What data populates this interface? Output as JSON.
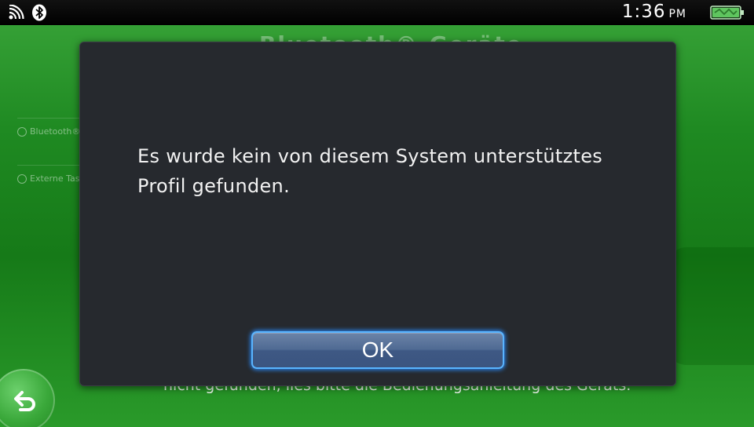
{
  "status_bar": {
    "time": "1:36",
    "ampm": "PM",
    "icons": [
      "wifi-icon",
      "bluetooth-icon",
      "battery-icon"
    ],
    "battery_color": "#5fc55f"
  },
  "background": {
    "title": "Bluetooth®-Geräte",
    "items": [
      {
        "label": "Bluetooth®-Geräte"
      },
      {
        "label": "Externe Tastatur"
      }
    ],
    "footer_text": "nicht gefunden, lies bitte die Bedienungsanleitung des Geräts.",
    "accent_color": "#1f8a22"
  },
  "dialog": {
    "message": "Es wurde kein von diesem System unterstütztes Profil gefunden.",
    "ok_label": "OK",
    "background_color": "#26292e",
    "button_glow_color": "#59b4ff"
  }
}
